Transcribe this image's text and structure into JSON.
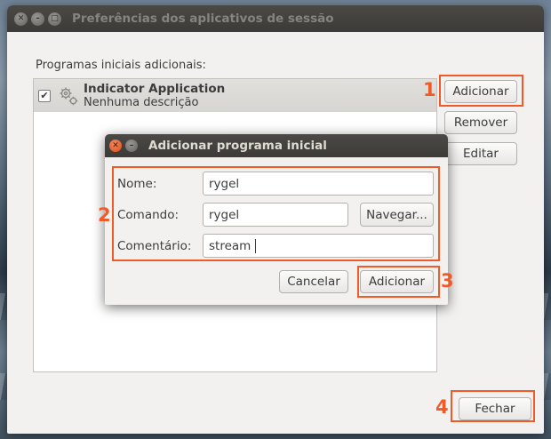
{
  "window": {
    "title": "Preferências dos aplicativos de sessão",
    "section_label": "Programas iniciais adicionais:",
    "programs": [
      {
        "name": "Indicator Application",
        "description": "Nenhuma descrição",
        "checked": true
      }
    ],
    "buttons": {
      "add": "Adicionar",
      "remove": "Remover",
      "edit": "Editar",
      "close": "Fechar"
    }
  },
  "dialog": {
    "title": "Adicionar programa inicial",
    "fields": {
      "name": {
        "label": "Nome:",
        "value": "rygel"
      },
      "command": {
        "label": "Comando:",
        "value": "rygel"
      },
      "comment": {
        "label": "Comentário:",
        "value": "stream"
      }
    },
    "buttons": {
      "browse": "Navegar...",
      "cancel": "Cancelar",
      "add": "Adicionar"
    }
  },
  "annotations": {
    "n1": "1",
    "n2": "2",
    "n3": "3",
    "n4": "4",
    "color": "#f05a28"
  },
  "icons": {
    "row_icon": "gears-icon",
    "check": "check-icon"
  }
}
